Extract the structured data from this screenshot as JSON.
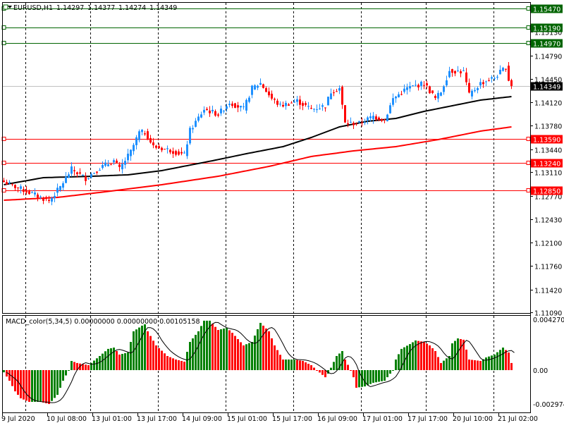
{
  "header": {
    "symbol_label": "EURUSD,H1",
    "open": "1.14297",
    "high": "1.14377",
    "low": "1.14274",
    "close": "1.14349"
  },
  "colors": {
    "bull": "#1e90ff",
    "bear": "#ff0000",
    "ma_fast": "#000000",
    "ma_slow": "#ff0000",
    "support": "#ff0000",
    "resistance": "#006400",
    "hist_up": "#008000",
    "hist_down": "#ff0000"
  },
  "price_axis": {
    "ticks": [
      "1.15130",
      "1.14790",
      "1.14450",
      "1.14120",
      "1.13780",
      "1.13440",
      "1.13110",
      "1.12770",
      "1.12430",
      "1.12100",
      "1.11760",
      "1.11420",
      "1.11090"
    ]
  },
  "current_price": "1.14349",
  "resistance_lines": [
    "1.15470",
    "1.15190",
    "1.14970"
  ],
  "support_lines": [
    "1.13590",
    "1.13240",
    "1.12850"
  ],
  "macd": {
    "title": "MACD_color(5,34,5) 0.00000000 0.00000000 0.00105158",
    "axis_top": "0.0042709",
    "axis_zero": "0.00",
    "axis_bottom": "-0.002974"
  },
  "time_axis": [
    "9 Jul 2020",
    "10 Jul 08:00",
    "13 Jul 01:00",
    "13 Jul 17:00",
    "14 Jul 09:00",
    "15 Jul 01:00",
    "15 Jul 17:00",
    "16 Jul 09:00",
    "17 Jul 01:00",
    "17 Jul 17:00",
    "20 Jul 10:00",
    "21 Jul 02:00"
  ],
  "chart_data": {
    "type": "candlestick",
    "bars": 181,
    "close_anchors": [
      [
        0,
        1.12968
      ],
      [
        6,
        1.12867
      ],
      [
        16,
        1.12694
      ],
      [
        20,
        1.12897
      ],
      [
        24,
        1.13151
      ],
      [
        29,
        1.13019
      ],
      [
        34,
        1.13171
      ],
      [
        39,
        1.13273
      ],
      [
        41,
        1.13151
      ],
      [
        45,
        1.13405
      ],
      [
        48,
        1.13679
      ],
      [
        50,
        1.13679
      ],
      [
        53,
        1.13476
      ],
      [
        59,
        1.13425
      ],
      [
        64,
        1.13354
      ],
      [
        66,
        1.13709
      ],
      [
        71,
        1.14014
      ],
      [
        76,
        1.13942
      ],
      [
        80,
        1.14115
      ],
      [
        85,
        1.14014
      ],
      [
        88,
        1.14318
      ],
      [
        91,
        1.14389
      ],
      [
        95,
        1.14166
      ],
      [
        98,
        1.14064
      ],
      [
        104,
        1.14135
      ],
      [
        109,
        1.14014
      ],
      [
        114,
        1.14064
      ],
      [
        116,
        1.14267
      ],
      [
        119,
        1.14318
      ],
      [
        121,
        1.13811
      ],
      [
        126,
        1.13811
      ],
      [
        131,
        1.13912
      ],
      [
        135,
        1.13861
      ],
      [
        138,
        1.14166
      ],
      [
        143,
        1.14318
      ],
      [
        149,
        1.14389
      ],
      [
        153,
        1.14166
      ],
      [
        155,
        1.14267
      ],
      [
        158,
        1.14572
      ],
      [
        163,
        1.14552
      ],
      [
        165,
        1.14217
      ],
      [
        169,
        1.14389
      ],
      [
        174,
        1.1447
      ],
      [
        178,
        1.14623
      ],
      [
        179,
        1.1444
      ],
      [
        180,
        1.14349
      ]
    ],
    "ma_fast_anchors": [
      [
        0,
        1.12928
      ],
      [
        14,
        1.13029
      ],
      [
        31,
        1.13049
      ],
      [
        44,
        1.1307
      ],
      [
        56,
        1.13131
      ],
      [
        74,
        1.13273
      ],
      [
        86,
        1.13374
      ],
      [
        99,
        1.13476
      ],
      [
        109,
        1.13608
      ],
      [
        119,
        1.1376
      ],
      [
        129,
        1.13841
      ],
      [
        139,
        1.13882
      ],
      [
        149,
        1.13983
      ],
      [
        159,
        1.14064
      ],
      [
        169,
        1.14146
      ],
      [
        180,
        1.14196
      ]
    ],
    "ma_slow_anchors": [
      [
        0,
        1.12704
      ],
      [
        19,
        1.12745
      ],
      [
        36,
        1.12826
      ],
      [
        56,
        1.12928
      ],
      [
        76,
        1.13049
      ],
      [
        94,
        1.13191
      ],
      [
        109,
        1.13334
      ],
      [
        124,
        1.13415
      ],
      [
        139,
        1.13476
      ],
      [
        154,
        1.13577
      ],
      [
        169,
        1.13699
      ],
      [
        180,
        1.1376
      ]
    ],
    "macd_hist_anchors_e4": [
      [
        0,
        -1.8
      ],
      [
        2,
        -8.8
      ],
      [
        4,
        -17.6
      ],
      [
        6,
        -23.4
      ],
      [
        9,
        -26.3
      ],
      [
        13,
        -26.3
      ],
      [
        16,
        -28.1
      ],
      [
        19,
        -20.5
      ],
      [
        21,
        -8.8
      ],
      [
        23,
        0
      ],
      [
        24,
        7.6
      ],
      [
        26,
        5.9
      ],
      [
        30,
        4.1
      ],
      [
        34,
        11.7
      ],
      [
        37,
        17.6
      ],
      [
        39,
        18.7
      ],
      [
        41,
        12.9
      ],
      [
        44,
        14.6
      ],
      [
        46,
        32.2
      ],
      [
        49,
        36.9
      ],
      [
        50,
        38
      ],
      [
        51,
        32.2
      ],
      [
        54,
        20.5
      ],
      [
        58,
        11.7
      ],
      [
        61,
        8.8
      ],
      [
        64,
        7
      ],
      [
        66,
        23.4
      ],
      [
        69,
        32.2
      ],
      [
        71,
        41
      ],
      [
        73,
        41
      ],
      [
        76,
        33.3
      ],
      [
        79,
        35.1
      ],
      [
        81,
        31
      ],
      [
        85,
        20.5
      ],
      [
        88,
        23.4
      ],
      [
        91,
        39.2
      ],
      [
        94,
        32.2
      ],
      [
        96,
        20.5
      ],
      [
        99,
        8.8
      ],
      [
        103,
        8.8
      ],
      [
        106,
        7.6
      ],
      [
        109,
        4.1
      ],
      [
        111,
        0
      ],
      [
        114,
        -5.9
      ],
      [
        115,
        -2.9
      ],
      [
        118,
        11.7
      ],
      [
        120,
        15.8
      ],
      [
        121,
        8.8
      ],
      [
        123,
        0
      ],
      [
        124,
        -5.9
      ],
      [
        125,
        -14.6
      ],
      [
        128,
        -13.5
      ],
      [
        131,
        -10.5
      ],
      [
        135,
        -8.8
      ],
      [
        138,
        0
      ],
      [
        139,
        8.8
      ],
      [
        141,
        17.6
      ],
      [
        144,
        21.6
      ],
      [
        146,
        24.6
      ],
      [
        149,
        23.4
      ],
      [
        151,
        20.5
      ],
      [
        153,
        15.8
      ],
      [
        155,
        5.9
      ],
      [
        158,
        11.7
      ],
      [
        159,
        22.2
      ],
      [
        161,
        26.3
      ],
      [
        163,
        25.2
      ],
      [
        165,
        8.8
      ],
      [
        169,
        7.6
      ],
      [
        171,
        10.5
      ],
      [
        174,
        12.9
      ],
      [
        177,
        18.7
      ],
      [
        179,
        14.6
      ],
      [
        180,
        5.9
      ]
    ],
    "macd_range": [
      -0.002974,
      0.0042709
    ]
  }
}
